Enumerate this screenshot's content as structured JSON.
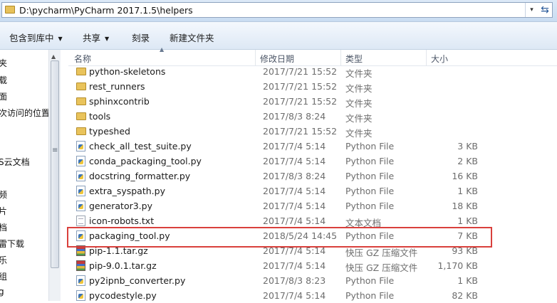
{
  "address": {
    "path": "D:\\pycharm\\PyCharm 2017.1.5\\helpers",
    "dropdown_glyph": "▾",
    "refresh_glyph": "⇆"
  },
  "toolbar": {
    "include_in_library": "包含到库中",
    "share": "共享",
    "burn": "刻录",
    "new_folder": "新建文件夹"
  },
  "nav": {
    "items": [
      "夹",
      "载",
      "面",
      "次访问的位置",
      "S云文档",
      "频",
      "片",
      "档",
      "雷下载",
      "乐",
      "组",
      "g"
    ]
  },
  "columns": {
    "name": "名称",
    "date": "修改日期",
    "type": "类型",
    "size": "大小"
  },
  "files": [
    {
      "name": "python-skeletons",
      "date": "2017/7/21 15:52",
      "type": "文件夹",
      "size": "",
      "icon": "folder-icon"
    },
    {
      "name": "rest_runners",
      "date": "2017/7/21 15:52",
      "type": "文件夹",
      "size": "",
      "icon": "folder-icon"
    },
    {
      "name": "sphinxcontrib",
      "date": "2017/7/21 15:52",
      "type": "文件夹",
      "size": "",
      "icon": "folder-icon"
    },
    {
      "name": "tools",
      "date": "2017/8/3 8:24",
      "type": "文件夹",
      "size": "",
      "icon": "folder-icon"
    },
    {
      "name": "typeshed",
      "date": "2017/7/21 15:52",
      "type": "文件夹",
      "size": "",
      "icon": "folder-icon"
    },
    {
      "name": "check_all_test_suite.py",
      "date": "2017/7/4 5:14",
      "type": "Python File",
      "size": "3 KB",
      "icon": "python-file-icon"
    },
    {
      "name": "conda_packaging_tool.py",
      "date": "2017/7/4 5:14",
      "type": "Python File",
      "size": "2 KB",
      "icon": "python-file-icon"
    },
    {
      "name": "docstring_formatter.py",
      "date": "2017/8/3 8:24",
      "type": "Python File",
      "size": "16 KB",
      "icon": "python-file-icon"
    },
    {
      "name": "extra_syspath.py",
      "date": "2017/7/4 5:14",
      "type": "Python File",
      "size": "1 KB",
      "icon": "python-file-icon"
    },
    {
      "name": "generator3.py",
      "date": "2017/7/4 5:14",
      "type": "Python File",
      "size": "18 KB",
      "icon": "python-file-icon"
    },
    {
      "name": "icon-robots.txt",
      "date": "2017/7/4 5:14",
      "type": "文本文档",
      "size": "1 KB",
      "icon": "text-file-icon"
    },
    {
      "name": "packaging_tool.py",
      "date": "2018/5/24 14:45",
      "type": "Python File",
      "size": "7 KB",
      "icon": "python-file-icon"
    },
    {
      "name": "pip-1.1.tar.gz",
      "date": "2017/7/4 5:14",
      "type": "快压 GZ 压缩文件",
      "size": "93 KB",
      "icon": "archive-icon"
    },
    {
      "name": "pip-9.0.1.tar.gz",
      "date": "2017/7/4 5:14",
      "type": "快压 GZ 压缩文件",
      "size": "1,170 KB",
      "icon": "archive-icon"
    },
    {
      "name": "py2ipnb_converter.py",
      "date": "2017/8/3 8:23",
      "type": "Python File",
      "size": "1 KB",
      "icon": "python-file-icon"
    },
    {
      "name": "pycodestyle.py",
      "date": "2017/7/4 5:14",
      "type": "Python File",
      "size": "82 KB",
      "icon": "python-file-icon"
    }
  ],
  "highlight_color": "#d9403c",
  "highlighted_file": "packaging_tool.py"
}
